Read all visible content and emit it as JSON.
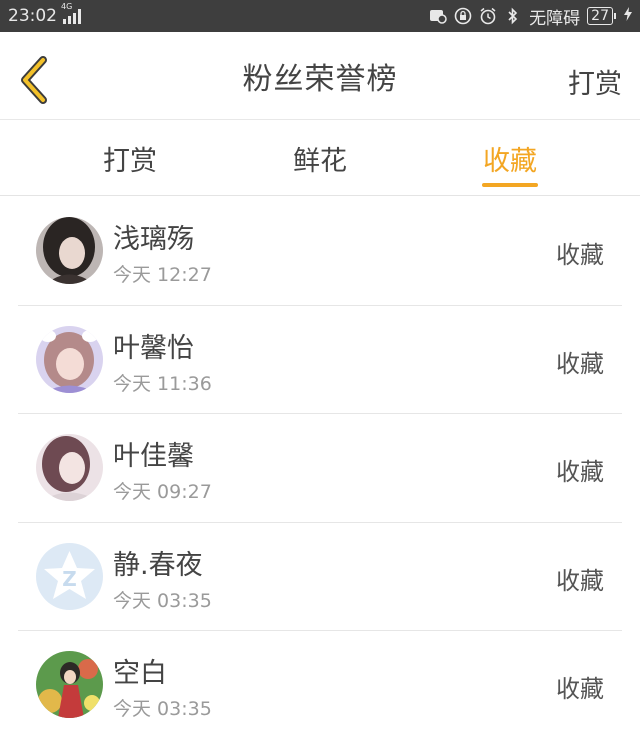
{
  "status_bar": {
    "time": "23:02",
    "network": "4G",
    "carrier_text": "无障碍",
    "battery": "27",
    "icons": [
      "sync-off-icon",
      "lock-rotation-icon",
      "alarm-icon",
      "bluetooth-icon"
    ]
  },
  "header": {
    "title": "粉丝荣誉榜",
    "right_action": "打赏",
    "back_icon": "chevron-left-icon"
  },
  "tabs": [
    {
      "label": "打赏",
      "active": false
    },
    {
      "label": "鲜花",
      "active": false
    },
    {
      "label": "收藏",
      "active": true
    }
  ],
  "accent_color": "#f3a623",
  "list": {
    "items": [
      {
        "name": "浅璃殇",
        "time": "今天 12:27",
        "action": "收藏"
      },
      {
        "name": "叶馨怡",
        "time": "今天 11:36",
        "action": "收藏"
      },
      {
        "name": "叶佳馨",
        "time": "今天 09:27",
        "action": "收藏"
      },
      {
        "name": "静.春夜",
        "time": "今天 03:35",
        "action": "收藏"
      },
      {
        "name": "空白",
        "time": "今天 03:35",
        "action": "收藏"
      }
    ]
  }
}
